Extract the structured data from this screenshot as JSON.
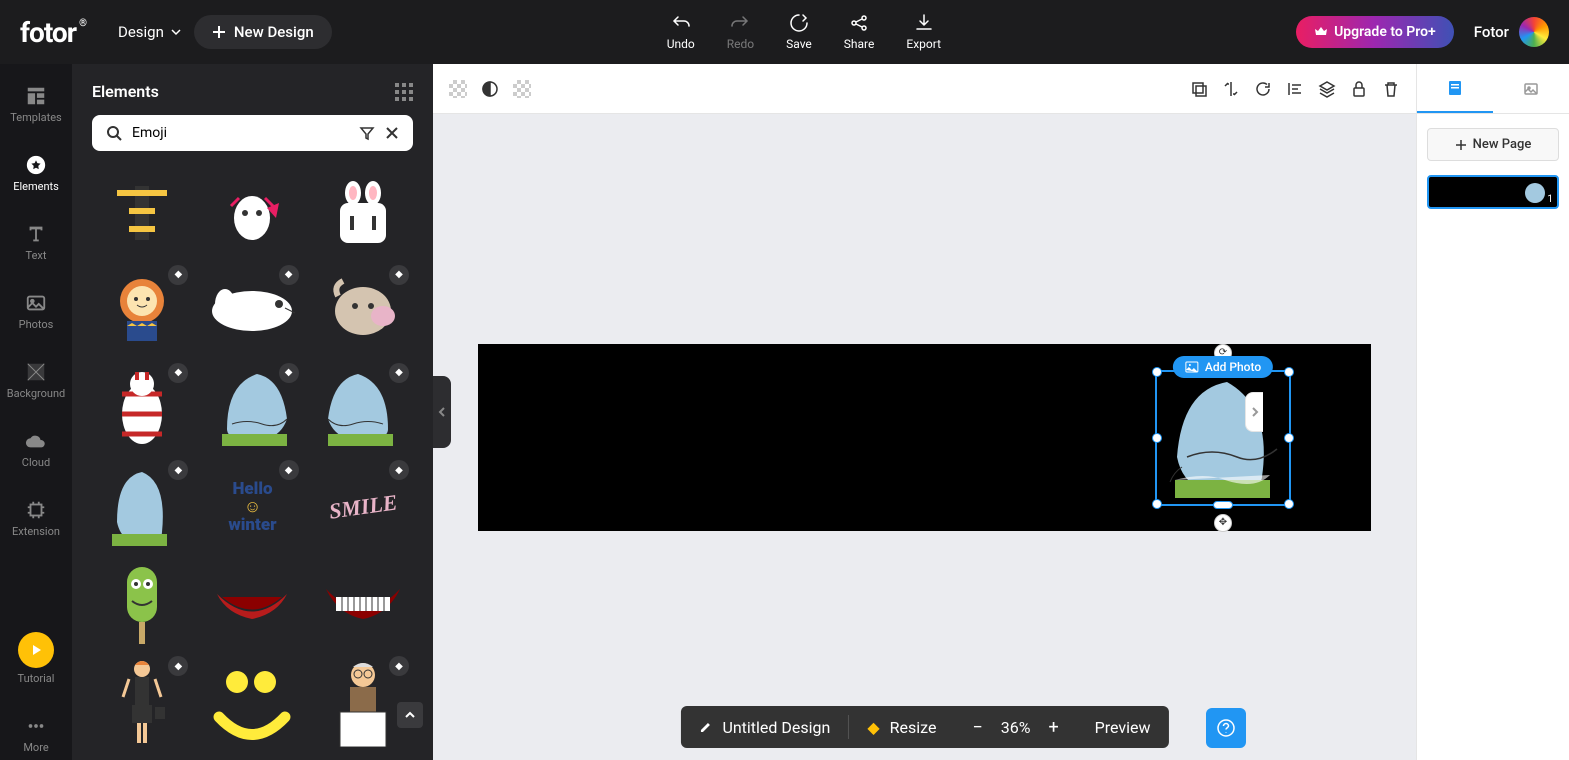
{
  "logo": "fotor",
  "header": {
    "design_menu": "Design",
    "new_design": "New Design",
    "actions": {
      "undo": "Undo",
      "redo": "Redo",
      "save": "Save",
      "share": "Share",
      "export": "Export"
    },
    "upgrade": "Upgrade to Pro+",
    "user": "Fotor"
  },
  "sidebar": {
    "templates": "Templates",
    "elements": "Elements",
    "text": "Text",
    "photos": "Photos",
    "background": "Background",
    "cloud": "Cloud",
    "extension": "Extension",
    "tutorial": "Tutorial",
    "more": "More"
  },
  "panel": {
    "title": "Elements",
    "search_value": "Emoji"
  },
  "canvas": {
    "add_photo": "Add Photo"
  },
  "right": {
    "new_page": "New Page",
    "page_number": "1"
  },
  "bottom": {
    "title": "Untitled Design",
    "resize": "Resize",
    "zoom": "36%",
    "preview": "Preview"
  }
}
